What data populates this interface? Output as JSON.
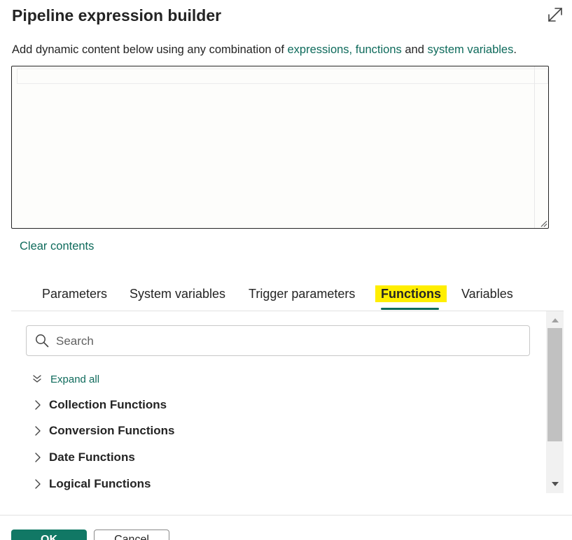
{
  "dialog": {
    "title": "Pipeline expression builder",
    "expand_icon": "expand-diagonal-icon"
  },
  "description": {
    "prefix": "Add dynamic content below using any combination of ",
    "link_expressions": "expressions,",
    "link_functions": "functions",
    "middle": " and ",
    "link_system_variables": "system variables",
    "suffix": "."
  },
  "editor": {
    "value": ""
  },
  "clear_contents_label": "Clear contents",
  "tabs": [
    {
      "label": "Parameters",
      "active": false
    },
    {
      "label": "System variables",
      "active": false
    },
    {
      "label": "Trigger parameters",
      "active": false
    },
    {
      "label": "Functions",
      "active": true
    },
    {
      "label": "Variables",
      "active": false
    }
  ],
  "functions_panel": {
    "search": {
      "placeholder": "Search",
      "value": "",
      "icon": "search-icon"
    },
    "expand_all_label": "Expand all",
    "expand_all_icon": "double-chevron-down-icon",
    "items": [
      {
        "label": "Collection Functions",
        "icon": "chevron-right-icon"
      },
      {
        "label": "Conversion Functions",
        "icon": "chevron-right-icon"
      },
      {
        "label": "Date Functions",
        "icon": "chevron-right-icon"
      },
      {
        "label": "Logical Functions",
        "icon": "chevron-right-icon"
      }
    ]
  },
  "footer": {
    "ok_label": "OK",
    "cancel_label": "Cancel"
  },
  "colors": {
    "accent": "#0f6b5c",
    "primary_button": "#117865",
    "active_tab_highlight": "#ffee00"
  }
}
